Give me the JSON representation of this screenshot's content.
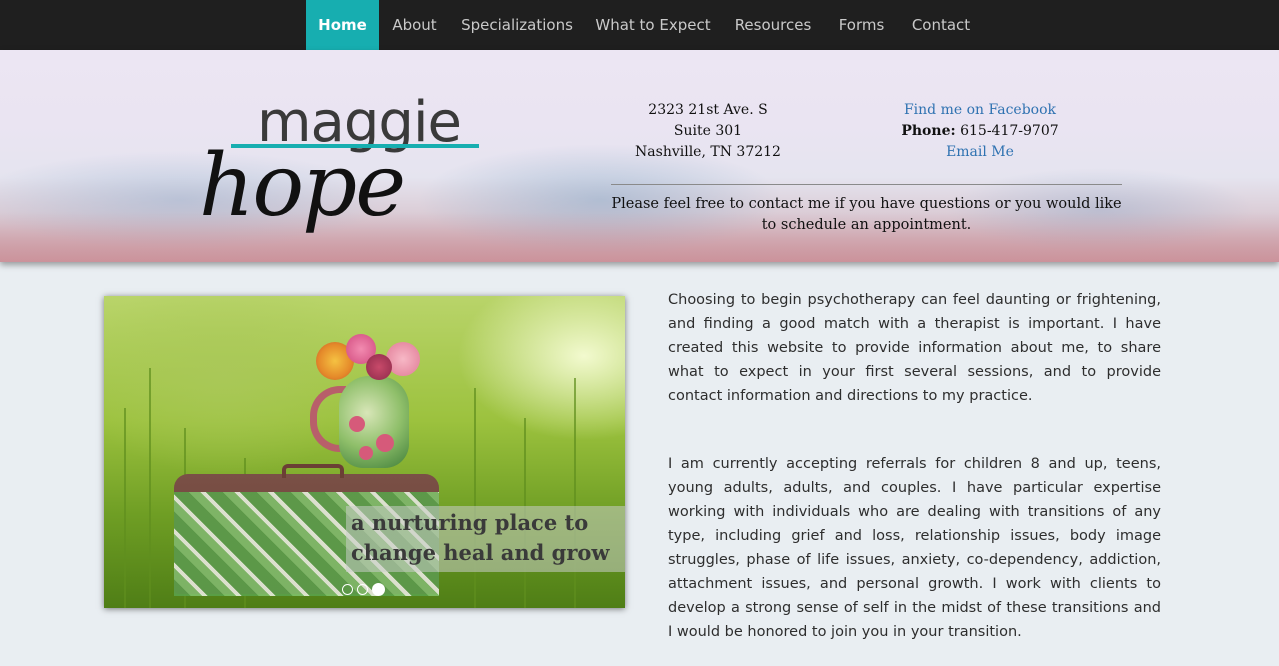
{
  "nav": {
    "items": [
      {
        "label": "Home",
        "active": true
      },
      {
        "label": "About",
        "active": false
      },
      {
        "label": "Specializations",
        "active": false
      },
      {
        "label": "What to Expect",
        "active": false
      },
      {
        "label": "Resources",
        "active": false
      },
      {
        "label": "Forms",
        "active": false
      },
      {
        "label": "Contact",
        "active": false
      }
    ],
    "accent_color": "#17aeb0",
    "background_color": "#1f1f1f"
  },
  "header": {
    "logo": {
      "line1": "maggie",
      "line2": "hope"
    },
    "address": {
      "line1": "2323 21st Ave. S",
      "line2": "Suite 301",
      "line3": "Nashville, TN 37212"
    },
    "contact": {
      "facebook_label": "Find me on Facebook",
      "phone_label": "Phone:",
      "phone_number": "615-417-9707",
      "email_label": "Email Me"
    },
    "note": "Please feel free to contact me if you have questions or you would like to schedule an appointment."
  },
  "slider": {
    "caption_line1": "a nurturing place to",
    "caption_line2": "change heal and grow",
    "slide_count": 3,
    "active_slide": 3
  },
  "content": {
    "paragraph1": "Choosing to begin psychotherapy can feel daunting or frightening, and finding a good match with a therapist is important. I have created this website to provide information about me, to share what to expect in your first several sessions, and to provide contact information and directions to my practice.",
    "paragraph2": "I am currently accepting referrals for children 8 and up, teens, young adults, adults, and couples. I have particular expertise working with individuals who are dealing with transitions of any type, including grief and loss, relationship issues, body image struggles, phase of life issues, anxiety, co-dependency, addiction, attachment issues, and personal growth. I work with clients to develop a strong sense of self in the midst of these transitions and I would be honored to join you in your transition."
  },
  "colors": {
    "link": "#2f72b1",
    "page_background": "#e9eef2",
    "text": "#2e2e2e"
  }
}
